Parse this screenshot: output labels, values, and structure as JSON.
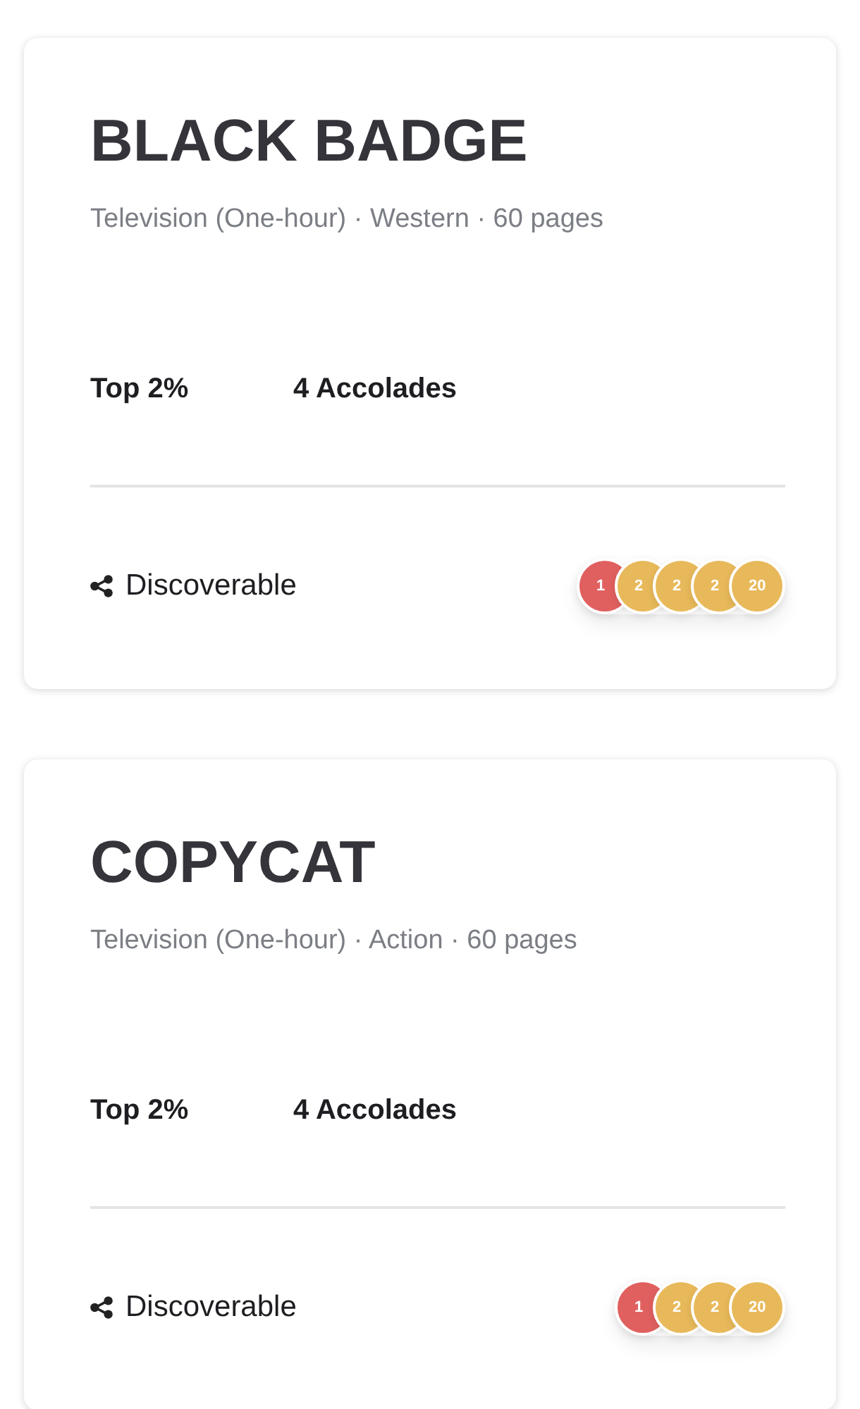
{
  "cards": [
    {
      "title": "BLACK BADGE",
      "subtitle": "Television (One-hour) · Western · 60 pages",
      "stats": [
        "Top 2%",
        "4 Accolades"
      ],
      "visibility": "Discoverable",
      "badges": [
        {
          "label": "1",
          "color": "#e0605f"
        },
        {
          "label": "2",
          "color": "#e8b95a"
        },
        {
          "label": "2",
          "color": "#e8b95a"
        },
        {
          "label": "2",
          "color": "#e8b95a"
        },
        {
          "label": "20",
          "color": "#e8b95a"
        }
      ]
    },
    {
      "title": "COPYCAT",
      "subtitle": "Television (One-hour) · Action · 60 pages",
      "stats": [
        "Top 2%",
        "4 Accolades"
      ],
      "visibility": "Discoverable",
      "badges": [
        {
          "label": "1",
          "color": "#e0605f"
        },
        {
          "label": "2",
          "color": "#e8b95a"
        },
        {
          "label": "2",
          "color": "#e8b95a"
        },
        {
          "label": "20",
          "color": "#e8b95a"
        }
      ]
    }
  ]
}
